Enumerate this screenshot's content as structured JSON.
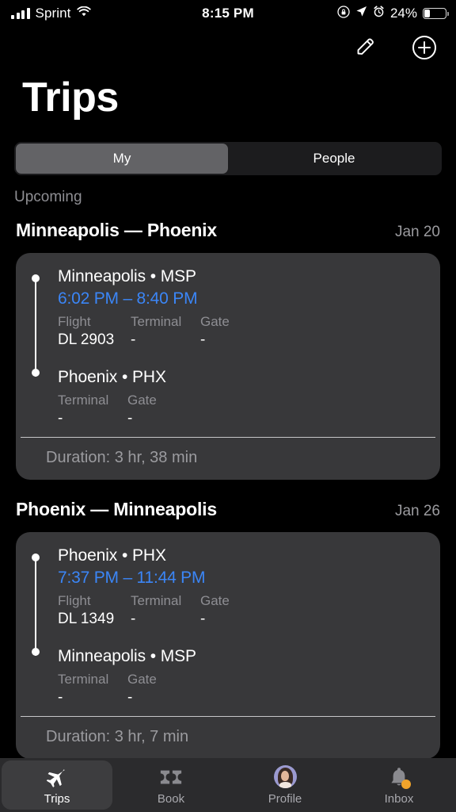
{
  "status_bar": {
    "carrier": "Sprint",
    "time": "8:15 PM",
    "battery_percent": "24%",
    "battery_level": 24,
    "icons": [
      "signal-bars-icon",
      "wifi-icon",
      "rotation-lock-icon",
      "location-arrow-icon",
      "alarm-clock-icon",
      "battery-icon"
    ]
  },
  "nav": {
    "edit_icon": "pencil-icon",
    "add_icon": "plus-circle-icon"
  },
  "header": {
    "title": "Trips"
  },
  "segmented": {
    "options": [
      {
        "label": "My",
        "selected": true
      },
      {
        "label": "People",
        "selected": false
      }
    ]
  },
  "section": {
    "label": "Upcoming"
  },
  "colors": {
    "accent_blue": "#3b86f7",
    "card_bg": "#38383a",
    "badge_orange": "#f0a32b",
    "secondary_text": "#8e8e93"
  },
  "trips": [
    {
      "route": "Minneapolis — Phoenix",
      "date": "Jan 20",
      "departure": {
        "city": "Minneapolis",
        "code": "MSP",
        "separator": "•",
        "time_range": "6:02 PM – 8:40 PM",
        "columns": [
          {
            "label": "Flight",
            "value": "DL 2903"
          },
          {
            "label": "Terminal",
            "value": "-"
          },
          {
            "label": "Gate",
            "value": "-"
          }
        ]
      },
      "arrival": {
        "city": "Phoenix",
        "code": "PHX",
        "separator": "•",
        "columns": [
          {
            "label": "Terminal",
            "value": "-"
          },
          {
            "label": "Gate",
            "value": "-"
          }
        ]
      },
      "duration": "Duration: 3 hr, 38 min"
    },
    {
      "route": "Phoenix — Minneapolis",
      "date": "Jan 26",
      "departure": {
        "city": "Phoenix",
        "code": "PHX",
        "separator": "•",
        "time_range": "7:37 PM – 11:44 PM",
        "columns": [
          {
            "label": "Flight",
            "value": "DL 1349"
          },
          {
            "label": "Terminal",
            "value": "-"
          },
          {
            "label": "Gate",
            "value": "-"
          }
        ]
      },
      "arrival": {
        "city": "Minneapolis",
        "code": "MSP",
        "separator": "•",
        "columns": [
          {
            "label": "Terminal",
            "value": "-"
          },
          {
            "label": "Gate",
            "value": "-"
          }
        ]
      },
      "duration": "Duration: 3 hr, 7 min"
    }
  ],
  "tabbar": {
    "items": [
      {
        "label": "Trips",
        "icon": "airplane-icon",
        "active": true,
        "badge": false
      },
      {
        "label": "Book",
        "icon": "ticket-icon",
        "active": false,
        "badge": false
      },
      {
        "label": "Profile",
        "icon": "avatar-photo",
        "active": false,
        "badge": false
      },
      {
        "label": "Inbox",
        "icon": "bell-icon",
        "active": false,
        "badge": true
      }
    ]
  }
}
